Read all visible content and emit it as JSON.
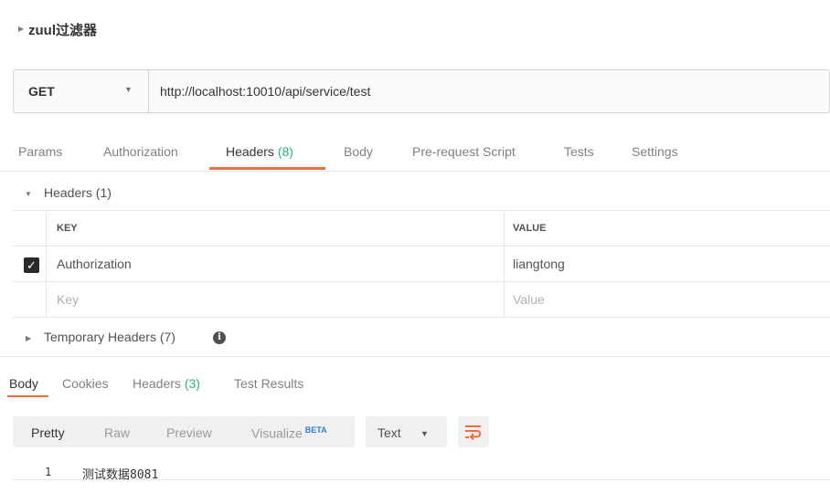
{
  "request": {
    "title": "zuul过滤器"
  },
  "url_bar": {
    "method": "GET",
    "url": "http://localhost:10010/api/service/test"
  },
  "tabs": [
    {
      "label": "Params"
    },
    {
      "label": "Authorization"
    },
    {
      "label": "Headers",
      "count": "(8)"
    },
    {
      "label": "Body"
    },
    {
      "label": "Pre-request Script"
    },
    {
      "label": "Tests"
    },
    {
      "label": "Settings"
    }
  ],
  "headers_section": {
    "label": "Headers (1)",
    "key_header": "KEY",
    "value_header": "VALUE",
    "rows": [
      {
        "key": "Authorization",
        "value": "liangtong",
        "checked": true
      }
    ],
    "key_placeholder": "Key",
    "value_placeholder": "Value"
  },
  "temporary_headers": {
    "label": "Temporary Headers (7)"
  },
  "response_tabs": [
    {
      "label": "Body"
    },
    {
      "label": "Cookies"
    },
    {
      "label": "Headers",
      "count": "(3)"
    },
    {
      "label": "Test Results"
    }
  ],
  "response_toolbar": {
    "pretty": "Pretty",
    "raw": "Raw",
    "preview": "Preview",
    "visualize": "Visualize",
    "beta": "BETA",
    "format": "Text"
  },
  "response_body": {
    "line_number": "1",
    "content": "测试数据8081"
  },
  "colors": {
    "accent": "#f26b3a",
    "count_green": "#26b47f",
    "beta_blue": "#2f7ed8"
  }
}
